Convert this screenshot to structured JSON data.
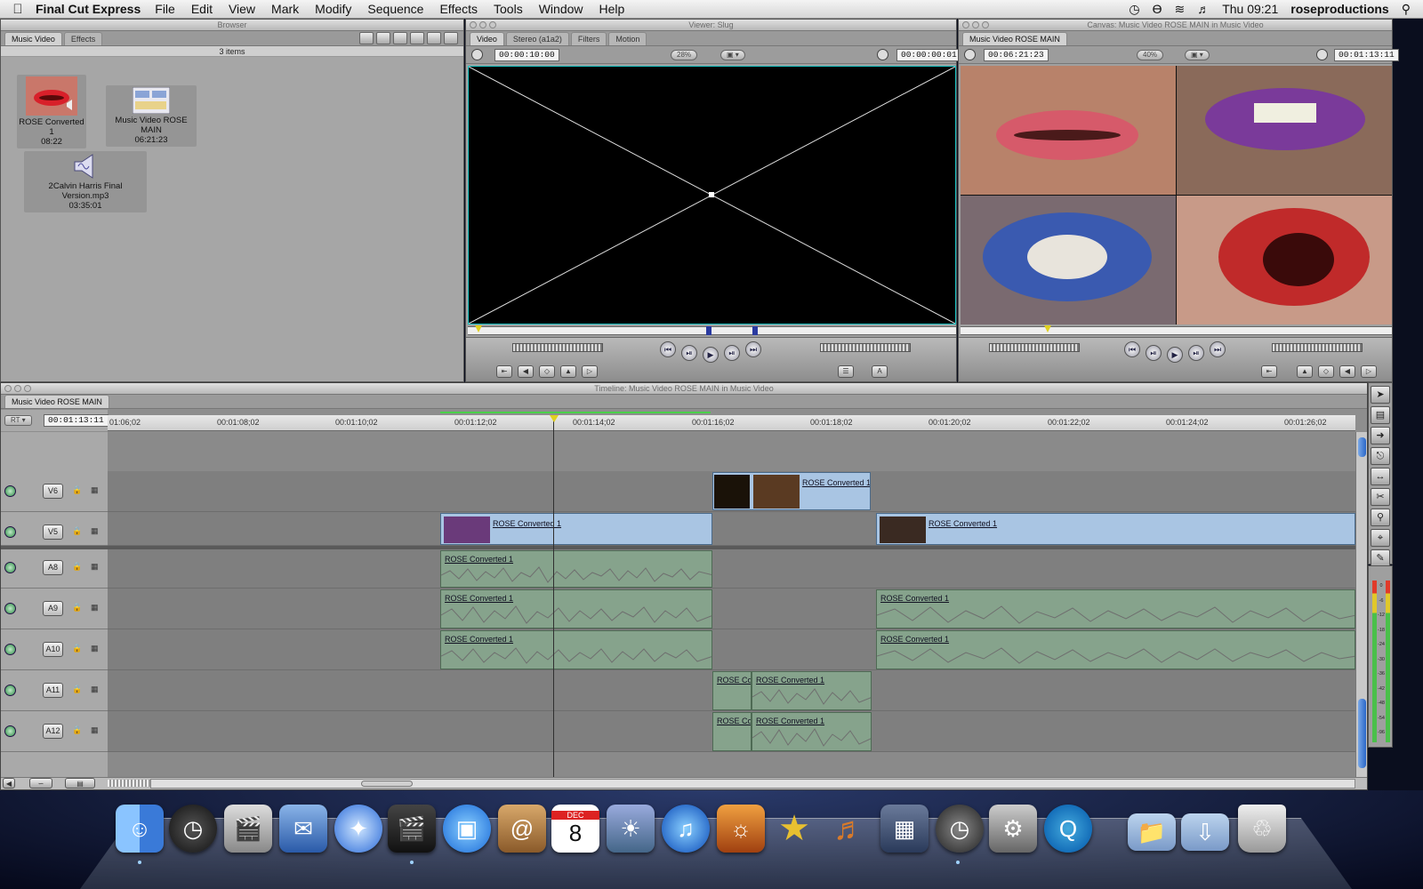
{
  "menubar": {
    "app_name": "Final Cut Express",
    "items": [
      "File",
      "Edit",
      "View",
      "Mark",
      "Modify",
      "Sequence",
      "Effects",
      "Tools",
      "Window",
      "Help"
    ],
    "clock": "Thu 09:21",
    "user": "roseproductions"
  },
  "browser": {
    "title": "Browser",
    "tabs": [
      "Music Video",
      "Effects"
    ],
    "item_count": "3 items",
    "items": [
      {
        "name": "ROSE Converted 1",
        "duration": "08:22",
        "icon": "video-clip-thumbnail"
      },
      {
        "name": "Music Video ROSE MAIN",
        "duration": "06:21:23",
        "icon": "sequence-icon"
      },
      {
        "name": "2Calvin Harris Final Version.mp3",
        "duration": "03:35:01",
        "icon": "audio-file-icon"
      }
    ]
  },
  "viewer": {
    "title": "Viewer: Slug",
    "tabs": [
      "Video",
      "Stereo (a1a2)",
      "Filters",
      "Motion"
    ],
    "duration_tc": "00:00:10:00",
    "zoom": "28%",
    "current_tc": "00:00:00:01"
  },
  "canvas": {
    "title": "Canvas: Music Video ROSE MAIN in Music Video",
    "tab": "Music Video ROSE MAIN",
    "duration_tc": "00:06:21:23",
    "zoom": "40%",
    "current_tc": "00:01:13:11"
  },
  "timeline": {
    "title": "Timeline: Music Video ROSE MAIN in Music Video",
    "tab": "Music Video ROSE MAIN",
    "rt_label": "RT",
    "current_tc": "00:01:13:11",
    "ruler_ticks": [
      "01:06;02",
      "00:01:08;02",
      "00:01:10;02",
      "00:01:12;02",
      "00:01:14;02",
      "00:01:16;02",
      "00:01:18;02",
      "00:01:20;02",
      "00:01:22;02",
      "00:01:24;02",
      "00:01:26;02"
    ],
    "tracks": {
      "v6": {
        "name": "V6",
        "clips": [
          "ROSE Converted 1"
        ]
      },
      "v5": {
        "name": "V5",
        "clips": [
          "ROSE Converted 1",
          "ROSE Converted 1"
        ]
      },
      "a8": {
        "name": "A8",
        "clips": [
          "ROSE Converted 1"
        ]
      },
      "a9": {
        "name": "A9",
        "clips": [
          "ROSE Converted 1",
          "ROSE Converted 1"
        ]
      },
      "a10": {
        "name": "A10",
        "clips": [
          "ROSE Converted 1",
          "ROSE Converted 1"
        ]
      },
      "a11": {
        "name": "A11",
        "clips": [
          "ROSE Co",
          "ROSE Converted 1"
        ]
      },
      "a12": {
        "name": "A12",
        "clips": [
          "ROSE Co",
          "ROSE Converted 1"
        ]
      }
    },
    "meter_labels": [
      "0",
      "-6",
      "-12",
      "-18",
      "-24",
      "-30",
      "-36",
      "-42",
      "-48",
      "-54",
      "-96"
    ]
  },
  "colors": {
    "video_clip": "#a9c5e3",
    "audio_clip": "#86a38c",
    "viewer_border": "#19c3c3"
  },
  "dock": {
    "apps": [
      "finder-icon",
      "dashboard-icon",
      "imovie-icon",
      "mail-icon",
      "safari-icon",
      "final-cut-icon",
      "ichat-icon",
      "address-book-icon",
      "ical-icon",
      "iphoto-icon",
      "itunes-icon",
      "iphoto-library-icon",
      "imovie-star-icon",
      "garageband-icon",
      "spaces-icon",
      "time-machine-icon",
      "system-preferences-icon",
      "quicktime-icon",
      "folder-icon",
      "downloads-icon",
      "trash-icon"
    ],
    "ical_month": "DEC",
    "ical_day": "8"
  }
}
